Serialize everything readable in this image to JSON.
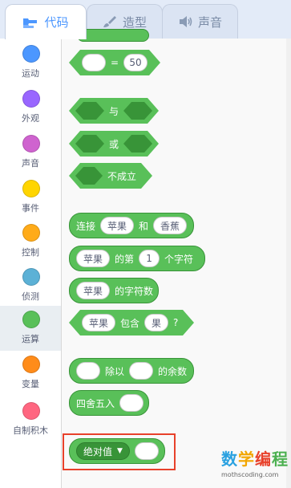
{
  "tabs": [
    {
      "label": "代码",
      "icon": "code-blocks-icon",
      "active": true
    },
    {
      "label": "造型",
      "icon": "paintbrush-icon",
      "active": false
    },
    {
      "label": "声音",
      "icon": "speaker-icon",
      "active": false
    }
  ],
  "categories": [
    {
      "label": "运动",
      "color": "#4c97ff"
    },
    {
      "label": "外观",
      "color": "#9966ff"
    },
    {
      "label": "声音",
      "color": "#cf63cf"
    },
    {
      "label": "事件",
      "color": "#ffd500"
    },
    {
      "label": "控制",
      "color": "#ffab19"
    },
    {
      "label": "侦测",
      "color": "#5cb1d6"
    },
    {
      "label": "运算",
      "color": "#59c059",
      "selected": true
    },
    {
      "label": "变量",
      "color": "#ff8c1a"
    },
    {
      "label": "自制积木",
      "color": "#ff6680"
    }
  ],
  "blocks": {
    "equals": {
      "op": "=",
      "value": "50"
    },
    "and": {
      "label": "与"
    },
    "or": {
      "label": "或"
    },
    "not": {
      "label": "不成立"
    },
    "join": {
      "prefix": "连接",
      "a": "苹果",
      "mid": "和",
      "b": "香蕉"
    },
    "letter_of": {
      "a": "苹果",
      "mid": "的第",
      "n": "1",
      "suffix": "个字符"
    },
    "length_of": {
      "a": "苹果",
      "suffix": "的字符数"
    },
    "contains": {
      "a": "苹果",
      "mid": "包含",
      "b": "果",
      "suffix": "?"
    },
    "mod": {
      "mid": "除以",
      "suffix": "的余数"
    },
    "round": {
      "label": "四舍五入"
    },
    "mathop": {
      "op": "绝对值"
    }
  },
  "watermark": {
    "title_chars": [
      "数",
      "学",
      "编",
      "程"
    ],
    "url": "mothscoding.com"
  },
  "colors": {
    "operators": "#59c059",
    "operators_dark": "#389438",
    "highlight": "#e8412b",
    "accent": "#4c97ff"
  }
}
